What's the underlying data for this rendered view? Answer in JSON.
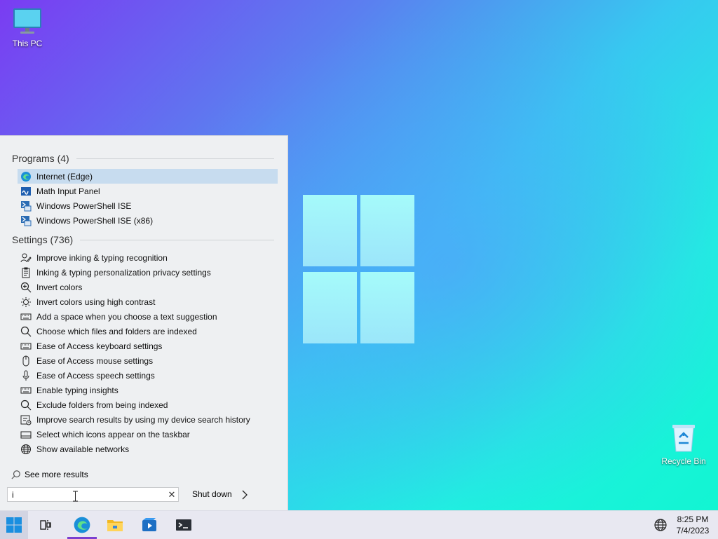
{
  "desktop": {
    "icons": [
      {
        "label": "This PC",
        "icon": "computer-icon"
      },
      {
        "label": "Recycle Bin",
        "icon": "recycle-bin-icon"
      }
    ]
  },
  "menu": {
    "groups": [
      {
        "heading": "Programs (4)",
        "items": [
          {
            "label": "Internet (Edge)",
            "icon": "edge-icon",
            "selected": true
          },
          {
            "label": "Math Input Panel",
            "icon": "math-input-icon"
          },
          {
            "label": "Windows PowerShell ISE",
            "icon": "powershell-ise-icon"
          },
          {
            "label": "Windows PowerShell ISE (x86)",
            "icon": "powershell-ise-icon"
          }
        ]
      },
      {
        "heading": "Settings (736)",
        "items": [
          {
            "label": "Improve inking & typing recognition",
            "icon": "person-pen-icon"
          },
          {
            "label": "Inking & typing personalization privacy settings",
            "icon": "clipboard-icon"
          },
          {
            "label": "Invert colors",
            "icon": "magnifier-plus-icon"
          },
          {
            "label": "Invert colors using high contrast",
            "icon": "sun-icon"
          },
          {
            "label": "Add a space when you choose a text suggestion",
            "icon": "keyboard-icon"
          },
          {
            "label": "Choose which files and folders are indexed",
            "icon": "search-icon"
          },
          {
            "label": "Ease of Access keyboard settings",
            "icon": "keyboard-icon"
          },
          {
            "label": "Ease of Access mouse settings",
            "icon": "mouse-icon"
          },
          {
            "label": "Ease of Access speech settings",
            "icon": "microphone-icon"
          },
          {
            "label": "Enable typing insights",
            "icon": "keyboard-icon"
          },
          {
            "label": "Exclude folders from being indexed",
            "icon": "search-icon"
          },
          {
            "label": "Improve search results by using my device search history",
            "icon": "history-icon"
          },
          {
            "label": "Select which icons appear on the taskbar",
            "icon": "taskbar-icon"
          },
          {
            "label": "Show available networks",
            "icon": "globe-icon"
          }
        ]
      }
    ],
    "see_more": "See more results",
    "search": {
      "value": "i"
    },
    "shutdown_label": "Shut down"
  },
  "taskbar": {
    "apps": [
      "start-icon",
      "task-view-icon",
      "edge-icon",
      "file-explorer-icon",
      "media-player-icon",
      "terminal-icon"
    ],
    "clock": {
      "time": "8:25 PM",
      "date": "7/4/2023"
    }
  },
  "colors": {
    "selection": "#c7dcef",
    "accent": "#7b3fd0"
  }
}
